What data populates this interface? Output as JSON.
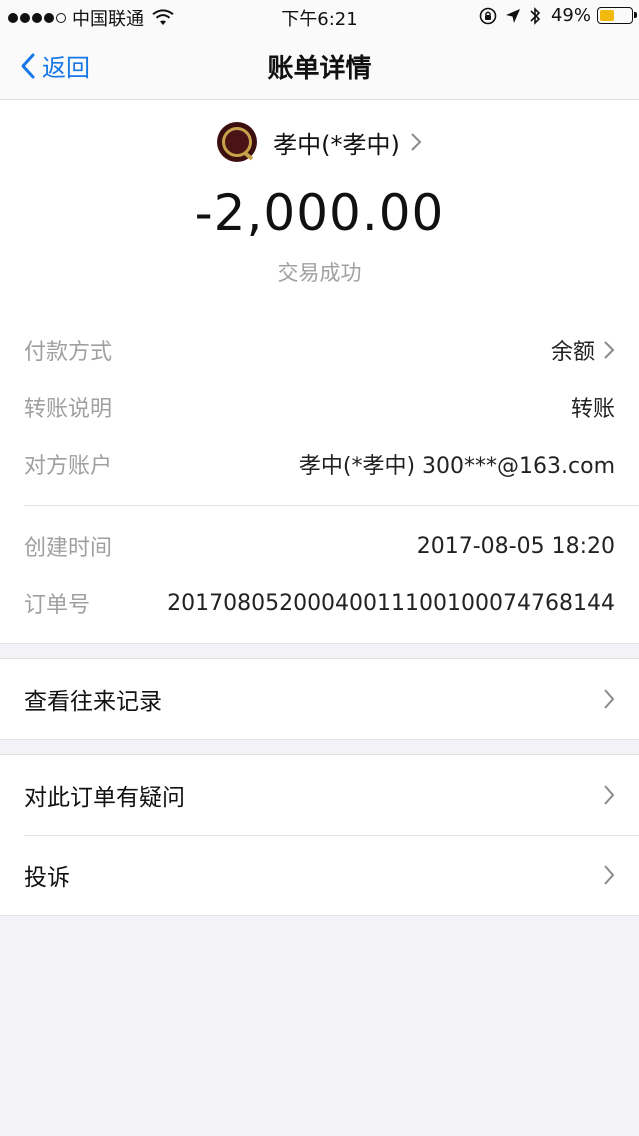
{
  "status_bar": {
    "carrier": "中国联通",
    "time": "下午6:21",
    "battery_percent": "49%",
    "battery_level": 0.49,
    "battery_color": "#f2b90f"
  },
  "nav": {
    "back_label": "返回",
    "title": "账单详情"
  },
  "payee": {
    "name": "孝中(*孝中)"
  },
  "transaction": {
    "amount": "-2,000.00",
    "status": "交易成功"
  },
  "details": [
    {
      "label": "付款方式",
      "value": "余额",
      "has_chevron": true
    },
    {
      "label": "转账说明",
      "value": "转账",
      "has_chevron": false
    },
    {
      "label": "对方账户",
      "value": "孝中(*孝中) 300***@163.com",
      "has_chevron": false
    },
    {
      "label": "创建时间",
      "value": "2017-08-05 18:20",
      "has_chevron": false
    },
    {
      "label": "订单号",
      "value": "20170805200040011100100074768144",
      "has_chevron": false
    }
  ],
  "menu": {
    "history": "查看往来记录",
    "question": "对此订单有疑问",
    "complaint": "投诉"
  },
  "colors": {
    "accent": "#1677e6",
    "secondary_text": "#a0a0a0",
    "background": "#f3f3f7"
  }
}
